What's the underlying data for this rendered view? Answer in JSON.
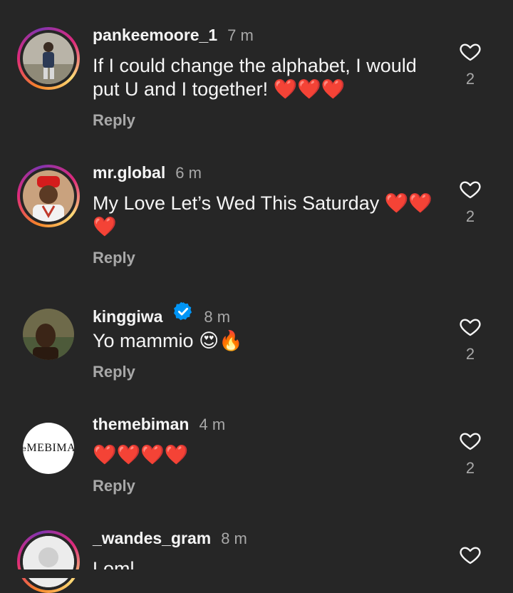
{
  "comments": [
    {
      "username": "pankeemoore_1",
      "time": "7 m",
      "text": "If I could change the alphabet, I would put U and I together! ",
      "emojis": "❤️❤️❤️",
      "reply": "Reply",
      "likes": "2"
    },
    {
      "username": "mr.global",
      "time": "6 m",
      "text": "My Love Let’s Wed This Saturday ",
      "emojis": "❤️❤️❤️",
      "reply": "Reply",
      "likes": "2"
    },
    {
      "username": "kinggiwa",
      "time": "8 m",
      "text": "Yo mammio ",
      "emojis": "😍🔥",
      "reply": "Reply",
      "likes": "2",
      "verified": true
    },
    {
      "username": "themebiman",
      "time": "4 m",
      "text": "",
      "emojis": "❤️❤️❤️❤️",
      "reply": "Reply",
      "likes": "2",
      "avatar_text_small": "the",
      "avatar_text_big": "MEBIMAN"
    },
    {
      "username": "_wandes_gram",
      "time": "8 m",
      "text": "Loml",
      "emojis": "",
      "reply": "",
      "likes": ""
    }
  ],
  "colors": {
    "background": "#262626",
    "secondary_text": "#a8a8a8",
    "heart": "#e0162b",
    "verified": "#0095f6"
  }
}
